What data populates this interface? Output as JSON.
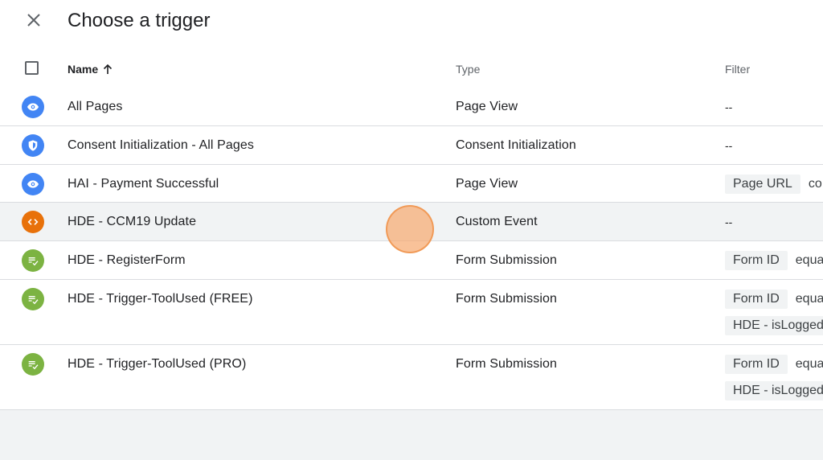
{
  "header": {
    "title": "Choose a trigger",
    "close_icon": "close-icon"
  },
  "table": {
    "columns": {
      "name": "Name",
      "type": "Type",
      "filter": "Filter"
    },
    "sort": {
      "column": "Name",
      "direction": "ascending",
      "icon": "arrow-up-icon"
    },
    "rows": [
      {
        "icon": "page-view-icon",
        "color": "#4285f4",
        "name": "All Pages",
        "type": "Page View",
        "filter_text": "--",
        "conditions": []
      },
      {
        "icon": "consent-shield-icon",
        "color": "#4285f4",
        "name": "Consent Initialization - All Pages",
        "type": "Consent Initialization",
        "filter_text": "--",
        "conditions": []
      },
      {
        "icon": "page-view-icon",
        "color": "#4285f4",
        "name": "HAI - Payment Successful",
        "type": "Page View",
        "filter_text": "",
        "conditions": [
          {
            "variable": "Page URL",
            "operator": "co"
          }
        ]
      },
      {
        "icon": "custom-event-icon",
        "color": "#e8710a",
        "name": "HDE - CCM19 Update",
        "type": "Custom Event",
        "filter_text": "--",
        "conditions": []
      },
      {
        "icon": "form-submission-icon",
        "color": "#7cb342",
        "name": "HDE - RegisterForm",
        "type": "Form Submission",
        "filter_text": "",
        "conditions": [
          {
            "variable": "Form ID",
            "operator": "equa"
          }
        ]
      },
      {
        "icon": "form-submission-icon",
        "color": "#7cb342",
        "name": "HDE - Trigger-ToolUsed (FREE)",
        "type": "Form Submission",
        "filter_text": "",
        "conditions": [
          {
            "variable": "Form ID",
            "operator": "equa"
          },
          {
            "variable": "HDE - isLogged",
            "operator": ""
          }
        ]
      },
      {
        "icon": "form-submission-icon",
        "color": "#7cb342",
        "name": "HDE - Trigger-ToolUsed (PRO)",
        "type": "Form Submission",
        "filter_text": "",
        "conditions": [
          {
            "variable": "Form ID",
            "operator": "equa"
          },
          {
            "variable": "HDE - isLogged",
            "operator": ""
          }
        ]
      }
    ]
  },
  "colors": {
    "page_view": "#4285f4",
    "custom_event": "#e8710a",
    "form_submission": "#7cb342",
    "hover_row": "#f1f3f4",
    "divider": "#dadce0"
  }
}
